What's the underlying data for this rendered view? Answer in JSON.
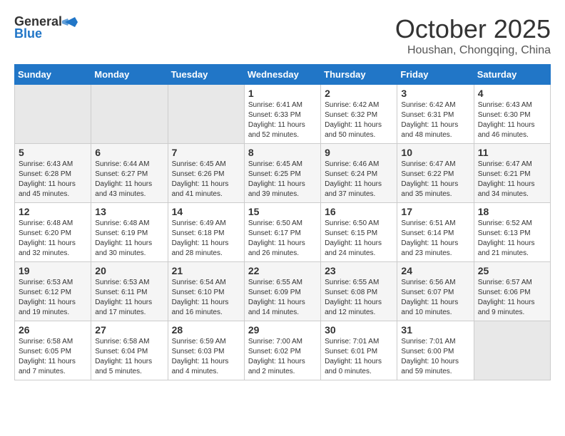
{
  "header": {
    "logo_general": "General",
    "logo_blue": "Blue",
    "month_title": "October 2025",
    "location": "Houshan, Chongqing, China"
  },
  "days_of_week": [
    "Sunday",
    "Monday",
    "Tuesday",
    "Wednesday",
    "Thursday",
    "Friday",
    "Saturday"
  ],
  "weeks": [
    [
      {
        "day": "",
        "sunrise": "",
        "sunset": "",
        "daylight": "",
        "empty": true
      },
      {
        "day": "",
        "sunrise": "",
        "sunset": "",
        "daylight": "",
        "empty": true
      },
      {
        "day": "",
        "sunrise": "",
        "sunset": "",
        "daylight": "",
        "empty": true
      },
      {
        "day": "1",
        "sunrise": "Sunrise: 6:41 AM",
        "sunset": "Sunset: 6:33 PM",
        "daylight": "Daylight: 11 hours and 52 minutes."
      },
      {
        "day": "2",
        "sunrise": "Sunrise: 6:42 AM",
        "sunset": "Sunset: 6:32 PM",
        "daylight": "Daylight: 11 hours and 50 minutes."
      },
      {
        "day": "3",
        "sunrise": "Sunrise: 6:42 AM",
        "sunset": "Sunset: 6:31 PM",
        "daylight": "Daylight: 11 hours and 48 minutes."
      },
      {
        "day": "4",
        "sunrise": "Sunrise: 6:43 AM",
        "sunset": "Sunset: 6:30 PM",
        "daylight": "Daylight: 11 hours and 46 minutes."
      }
    ],
    [
      {
        "day": "5",
        "sunrise": "Sunrise: 6:43 AM",
        "sunset": "Sunset: 6:28 PM",
        "daylight": "Daylight: 11 hours and 45 minutes."
      },
      {
        "day": "6",
        "sunrise": "Sunrise: 6:44 AM",
        "sunset": "Sunset: 6:27 PM",
        "daylight": "Daylight: 11 hours and 43 minutes."
      },
      {
        "day": "7",
        "sunrise": "Sunrise: 6:45 AM",
        "sunset": "Sunset: 6:26 PM",
        "daylight": "Daylight: 11 hours and 41 minutes."
      },
      {
        "day": "8",
        "sunrise": "Sunrise: 6:45 AM",
        "sunset": "Sunset: 6:25 PM",
        "daylight": "Daylight: 11 hours and 39 minutes."
      },
      {
        "day": "9",
        "sunrise": "Sunrise: 6:46 AM",
        "sunset": "Sunset: 6:24 PM",
        "daylight": "Daylight: 11 hours and 37 minutes."
      },
      {
        "day": "10",
        "sunrise": "Sunrise: 6:47 AM",
        "sunset": "Sunset: 6:22 PM",
        "daylight": "Daylight: 11 hours and 35 minutes."
      },
      {
        "day": "11",
        "sunrise": "Sunrise: 6:47 AM",
        "sunset": "Sunset: 6:21 PM",
        "daylight": "Daylight: 11 hours and 34 minutes."
      }
    ],
    [
      {
        "day": "12",
        "sunrise": "Sunrise: 6:48 AM",
        "sunset": "Sunset: 6:20 PM",
        "daylight": "Daylight: 11 hours and 32 minutes."
      },
      {
        "day": "13",
        "sunrise": "Sunrise: 6:48 AM",
        "sunset": "Sunset: 6:19 PM",
        "daylight": "Daylight: 11 hours and 30 minutes."
      },
      {
        "day": "14",
        "sunrise": "Sunrise: 6:49 AM",
        "sunset": "Sunset: 6:18 PM",
        "daylight": "Daylight: 11 hours and 28 minutes."
      },
      {
        "day": "15",
        "sunrise": "Sunrise: 6:50 AM",
        "sunset": "Sunset: 6:17 PM",
        "daylight": "Daylight: 11 hours and 26 minutes."
      },
      {
        "day": "16",
        "sunrise": "Sunrise: 6:50 AM",
        "sunset": "Sunset: 6:15 PM",
        "daylight": "Daylight: 11 hours and 24 minutes."
      },
      {
        "day": "17",
        "sunrise": "Sunrise: 6:51 AM",
        "sunset": "Sunset: 6:14 PM",
        "daylight": "Daylight: 11 hours and 23 minutes."
      },
      {
        "day": "18",
        "sunrise": "Sunrise: 6:52 AM",
        "sunset": "Sunset: 6:13 PM",
        "daylight": "Daylight: 11 hours and 21 minutes."
      }
    ],
    [
      {
        "day": "19",
        "sunrise": "Sunrise: 6:53 AM",
        "sunset": "Sunset: 6:12 PM",
        "daylight": "Daylight: 11 hours and 19 minutes."
      },
      {
        "day": "20",
        "sunrise": "Sunrise: 6:53 AM",
        "sunset": "Sunset: 6:11 PM",
        "daylight": "Daylight: 11 hours and 17 minutes."
      },
      {
        "day": "21",
        "sunrise": "Sunrise: 6:54 AM",
        "sunset": "Sunset: 6:10 PM",
        "daylight": "Daylight: 11 hours and 16 minutes."
      },
      {
        "day": "22",
        "sunrise": "Sunrise: 6:55 AM",
        "sunset": "Sunset: 6:09 PM",
        "daylight": "Daylight: 11 hours and 14 minutes."
      },
      {
        "day": "23",
        "sunrise": "Sunrise: 6:55 AM",
        "sunset": "Sunset: 6:08 PM",
        "daylight": "Daylight: 11 hours and 12 minutes."
      },
      {
        "day": "24",
        "sunrise": "Sunrise: 6:56 AM",
        "sunset": "Sunset: 6:07 PM",
        "daylight": "Daylight: 11 hours and 10 minutes."
      },
      {
        "day": "25",
        "sunrise": "Sunrise: 6:57 AM",
        "sunset": "Sunset: 6:06 PM",
        "daylight": "Daylight: 11 hours and 9 minutes."
      }
    ],
    [
      {
        "day": "26",
        "sunrise": "Sunrise: 6:58 AM",
        "sunset": "Sunset: 6:05 PM",
        "daylight": "Daylight: 11 hours and 7 minutes."
      },
      {
        "day": "27",
        "sunrise": "Sunrise: 6:58 AM",
        "sunset": "Sunset: 6:04 PM",
        "daylight": "Daylight: 11 hours and 5 minutes."
      },
      {
        "day": "28",
        "sunrise": "Sunrise: 6:59 AM",
        "sunset": "Sunset: 6:03 PM",
        "daylight": "Daylight: 11 hours and 4 minutes."
      },
      {
        "day": "29",
        "sunrise": "Sunrise: 7:00 AM",
        "sunset": "Sunset: 6:02 PM",
        "daylight": "Daylight: 11 hours and 2 minutes."
      },
      {
        "day": "30",
        "sunrise": "Sunrise: 7:01 AM",
        "sunset": "Sunset: 6:01 PM",
        "daylight": "Daylight: 11 hours and 0 minutes."
      },
      {
        "day": "31",
        "sunrise": "Sunrise: 7:01 AM",
        "sunset": "Sunset: 6:00 PM",
        "daylight": "Daylight: 10 hours and 59 minutes."
      },
      {
        "day": "",
        "sunrise": "",
        "sunset": "",
        "daylight": "",
        "empty": true
      }
    ]
  ]
}
